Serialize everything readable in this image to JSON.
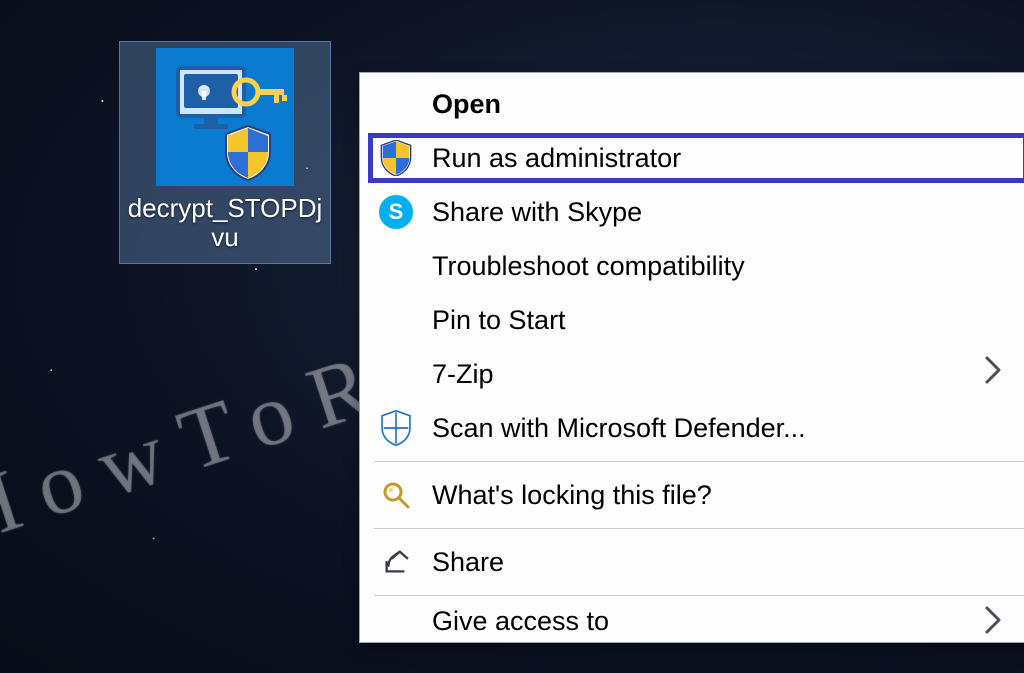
{
  "watermark": "HowToRemove.Guide",
  "desktop_icon": {
    "label": "decrypt_STOPDjvu"
  },
  "context_menu": {
    "items": [
      {
        "key": "open",
        "label": "Open",
        "bold": true,
        "icon": null,
        "submenu": false
      },
      {
        "key": "run-admin",
        "label": "Run as administrator",
        "bold": false,
        "icon": "uac-shield",
        "submenu": false,
        "highlighted": true
      },
      {
        "key": "share-skype",
        "label": "Share with Skype",
        "bold": false,
        "icon": "skype",
        "submenu": false
      },
      {
        "key": "troubleshoot",
        "label": "Troubleshoot compatibility",
        "bold": false,
        "icon": null,
        "submenu": false
      },
      {
        "key": "pin-start",
        "label": "Pin to Start",
        "bold": false,
        "icon": null,
        "submenu": false
      },
      {
        "key": "7zip",
        "label": "7-Zip",
        "bold": false,
        "icon": null,
        "submenu": true
      },
      {
        "key": "defender",
        "label": "Scan with Microsoft Defender...",
        "bold": false,
        "icon": "defender",
        "submenu": false
      },
      {
        "sep": true
      },
      {
        "key": "whats-locking",
        "label": "What's locking this file?",
        "bold": false,
        "icon": "magnifier",
        "submenu": false
      },
      {
        "sep": true
      },
      {
        "key": "share",
        "label": "Share",
        "bold": false,
        "icon": "share",
        "submenu": false
      },
      {
        "sep": true
      },
      {
        "key": "give-access",
        "label": "Give access to",
        "bold": false,
        "icon": null,
        "submenu": true,
        "partial": true
      }
    ]
  }
}
